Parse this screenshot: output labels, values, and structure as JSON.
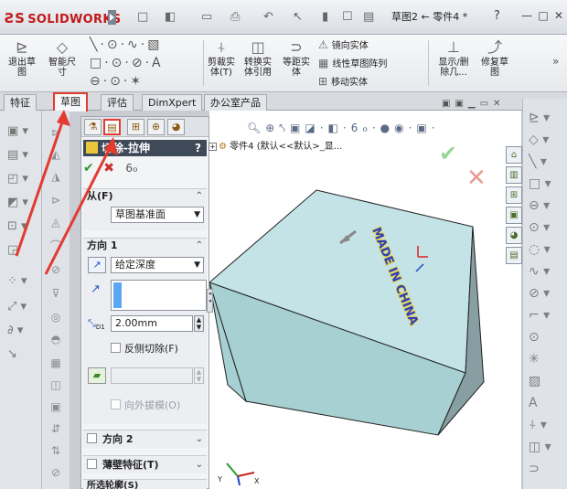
{
  "app": {
    "logo_ds": "ƧS",
    "logo_text": "SOLIDWORKS",
    "document_title": "草图2 ← 零件4 *",
    "help": "?",
    "window_buttons": {
      "minimize": "—",
      "restore": "□",
      "close": "✕"
    }
  },
  "quick_access": [
    "□",
    "◧",
    "▭",
    "⎙",
    "↶",
    "↖",
    "▮",
    "☐",
    "▤"
  ],
  "command_manager": {
    "exit_sketch": "退出草\n图",
    "smart_dim": "智能尺\n寸",
    "trim": "剪裁实\n体(T)",
    "convert": "转换实\n体引用",
    "offset": "等距实\n体",
    "mirror": "镜向实体",
    "linear_pattern": "线性草图阵列",
    "move": "移动实体",
    "show_delete": "显示/删\n除几...",
    "repair": "修复草\n图",
    "more": "»"
  },
  "tabs": [
    {
      "label": "特征",
      "active": false
    },
    {
      "label": "草图",
      "active": true
    },
    {
      "label": "评估",
      "active": false
    },
    {
      "label": "DimXpert",
      "active": false
    },
    {
      "label": "办公室产品",
      "active": false
    }
  ],
  "property_manager": {
    "title": "切除-拉伸",
    "help": "?",
    "from": {
      "heading": "从(F)",
      "value": "草图基准面"
    },
    "direction1": {
      "heading": "方向 1",
      "end_condition": "给定深度",
      "depth_label": "D1",
      "depth_value": "2.00mm",
      "flip_side_label": "反侧切除(F)",
      "draft_outward_label": "向外拔模(O)"
    },
    "direction2": "方向 2",
    "thin_feature": "薄壁特征(T)",
    "selected_contours": "所选轮廓(S)"
  },
  "graphics": {
    "tree_root": "零件4 (默认<<默认>_显...",
    "embossed_text": "MADE IN CHINA"
  },
  "triad_labels": {
    "x": "X",
    "y": "Y"
  },
  "colors": {
    "accent_red": "#e23b30",
    "cube_top": "#c3e3e7",
    "cube_left": "#a7d0d3",
    "cube_right": "#879fa2",
    "emboss_blue": "#2a3fbf",
    "emboss_yellow": "#e9d34b"
  }
}
